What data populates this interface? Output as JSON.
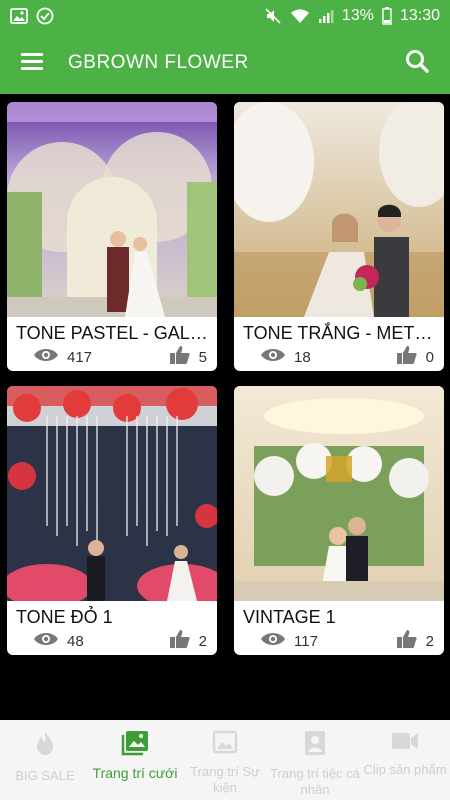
{
  "status": {
    "battery": "13%",
    "time": "13:30"
  },
  "appbar": {
    "title": "GBROWN FLOWER"
  },
  "cards": [
    {
      "name": "TONE PASTEL - GALA...",
      "views": "417",
      "likes": "5"
    },
    {
      "name": "TONE TRẮNG - METRO...",
      "views": "18",
      "likes": "0"
    },
    {
      "name": "TONE ĐỎ 1",
      "views": "48",
      "likes": "2"
    },
    {
      "name": "VINTAGE 1",
      "views": "117",
      "likes": "2"
    }
  ],
  "nav": [
    {
      "label": "BIG SALE",
      "icon": "fire-icon",
      "active": false
    },
    {
      "label": "Trang trí cưới",
      "icon": "gallery-icon",
      "active": true
    },
    {
      "label": "Trang trí Sự kiện",
      "icon": "image-icon",
      "active": false
    },
    {
      "label": "Trang trí tiệc cá nhân",
      "icon": "portrait-icon",
      "active": false
    },
    {
      "label": "Clip sản phẩm",
      "icon": "video-icon",
      "active": false
    }
  ],
  "colors": {
    "brand": "#4db246",
    "nav_active": "#3d9e35",
    "nav_inactive": "#cfcfcf"
  }
}
